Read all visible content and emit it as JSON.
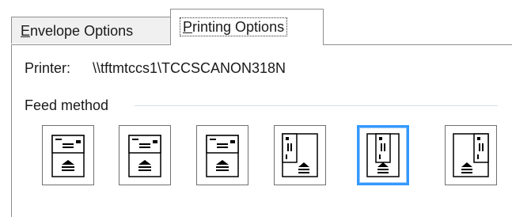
{
  "tabs": [
    {
      "label_pre": "",
      "label_accel": "E",
      "label_post": "nvelope Options",
      "selected": false
    },
    {
      "label_pre": "",
      "label_accel": "P",
      "label_post": "rinting Options",
      "selected": true
    }
  ],
  "printer": {
    "label": "Printer:",
    "value": "\\\\tftmtccs1\\TCCSCANON318N"
  },
  "feed_method": {
    "label": "Feed method",
    "options": [
      {
        "icon": "feed-horizontal-left-icon",
        "selected": false
      },
      {
        "icon": "feed-horizontal-center-icon",
        "selected": false
      },
      {
        "icon": "feed-horizontal-right-icon",
        "selected": false
      },
      {
        "icon": "feed-vertical-left-icon",
        "selected": false
      },
      {
        "icon": "feed-vertical-center-icon",
        "selected": true
      },
      {
        "icon": "feed-vertical-right-icon",
        "selected": false
      }
    ]
  },
  "colors": {
    "selection_border": "#3399ff",
    "tab_border": "#8f8f8f"
  }
}
